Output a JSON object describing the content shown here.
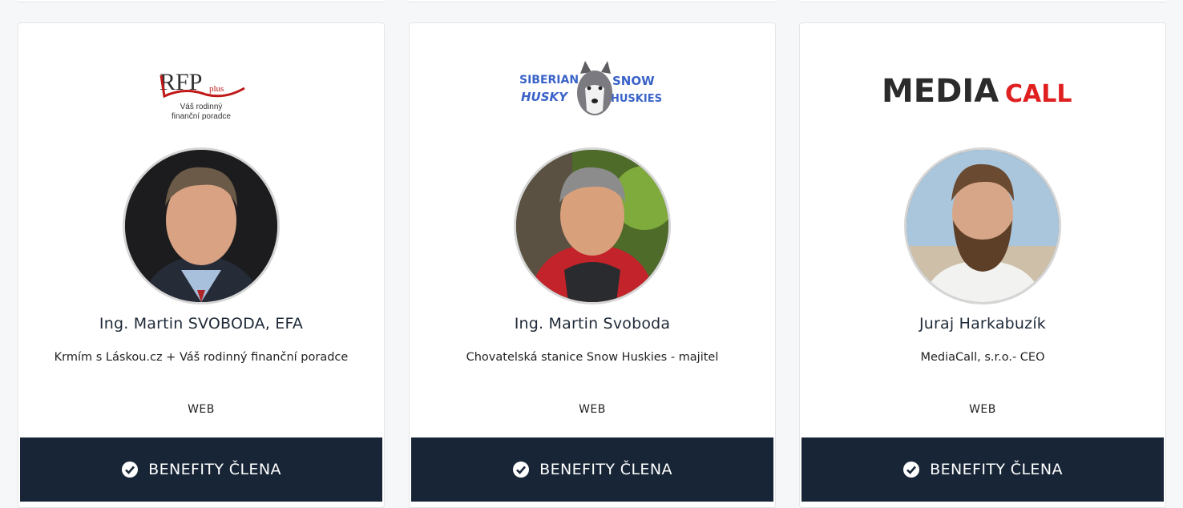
{
  "cards": [
    {
      "logo": {
        "main": "RFP",
        "sup": "plus",
        "line1": "Váš rodinný",
        "line2": "finanční poradce",
        "accent": "#c01818"
      },
      "name": "Ing. Martin SVOBODA, EFA",
      "role": "Krmím s Láskou.cz + Váš rodinný finanční poradce",
      "web": "WEB",
      "button": "BENEFITY ČLENA"
    },
    {
      "logo": {
        "w1": "SIBERIAN",
        "w2": "HUSKY",
        "w3": "SNOW",
        "w4": "HUSKIES",
        "accent": "#3a63c8"
      },
      "name": "Ing. Martin Svoboda",
      "role": "Chovatelská stanice Snow Huskies - majitel",
      "web": "WEB",
      "button": "BENEFITY ČLENA"
    },
    {
      "logo": {
        "part1": "MEDIA",
        "part2": "CALL",
        "dark": "#2b2b2b",
        "accent": "#e02020"
      },
      "name": "Juraj Harkabuzík",
      "role": "MediaCall, s.r.o.- CEO",
      "web": "WEB",
      "button": "BENEFITY ČLENA"
    }
  ],
  "colors": {
    "button_bg": "#172536",
    "card_border": "#e4e6e9"
  }
}
